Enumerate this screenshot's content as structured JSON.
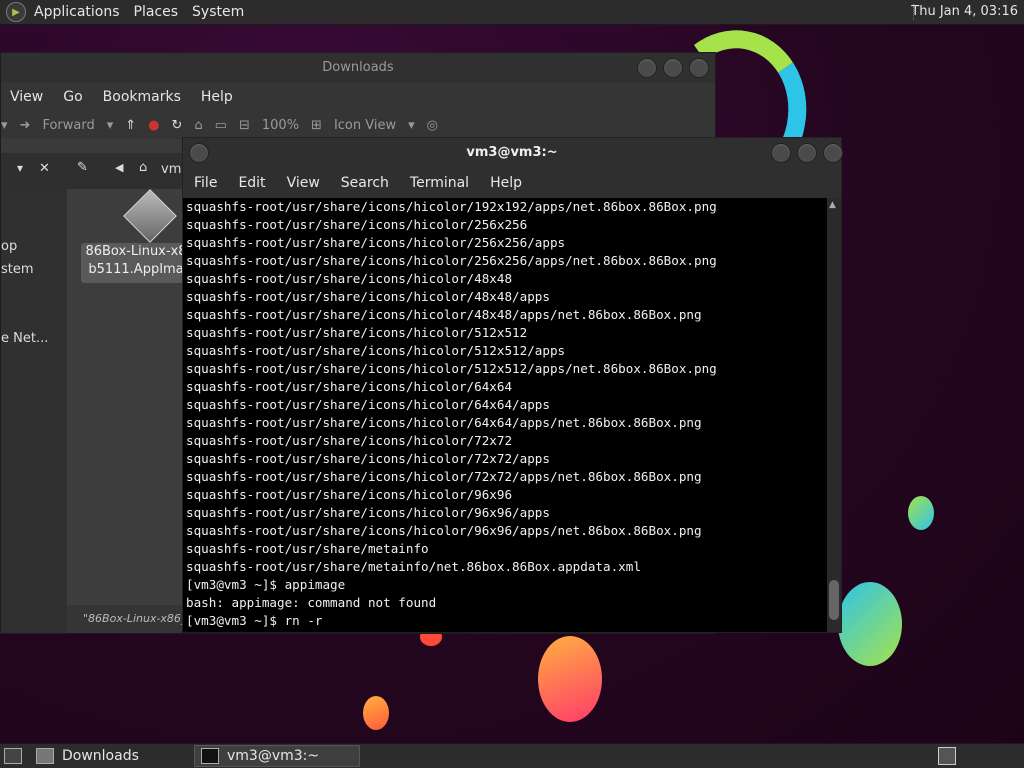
{
  "top_panel": {
    "menus": [
      "Applications",
      "Places",
      "System"
    ],
    "clock": "Thu Jan  4, 03:16"
  },
  "file_manager": {
    "title": "Downloads",
    "menus": [
      "View",
      "Go",
      "Bookmarks",
      "Help"
    ],
    "toolbar": {
      "forward_label": "Forward",
      "zoom": "100%",
      "view_mode": "Icon View"
    },
    "path_crumb": "vm3",
    "sidebar_items": [
      "op",
      "stem",
      "e Net..."
    ],
    "file_label_line1": "86Box-Linux-x8",
    "file_label_line2": "b5111.AppIma",
    "status": "\"86Box-Linux-x86_6"
  },
  "terminal": {
    "title": "vm3@vm3:~",
    "menus": [
      "File",
      "Edit",
      "View",
      "Search",
      "Terminal",
      "Help"
    ],
    "lines": [
      "squashfs-root/usr/share/icons/hicolor/192x192/apps/net.86box.86Box.png",
      "squashfs-root/usr/share/icons/hicolor/256x256",
      "squashfs-root/usr/share/icons/hicolor/256x256/apps",
      "squashfs-root/usr/share/icons/hicolor/256x256/apps/net.86box.86Box.png",
      "squashfs-root/usr/share/icons/hicolor/48x48",
      "squashfs-root/usr/share/icons/hicolor/48x48/apps",
      "squashfs-root/usr/share/icons/hicolor/48x48/apps/net.86box.86Box.png",
      "squashfs-root/usr/share/icons/hicolor/512x512",
      "squashfs-root/usr/share/icons/hicolor/512x512/apps",
      "squashfs-root/usr/share/icons/hicolor/512x512/apps/net.86box.86Box.png",
      "squashfs-root/usr/share/icons/hicolor/64x64",
      "squashfs-root/usr/share/icons/hicolor/64x64/apps",
      "squashfs-root/usr/share/icons/hicolor/64x64/apps/net.86box.86Box.png",
      "squashfs-root/usr/share/icons/hicolor/72x72",
      "squashfs-root/usr/share/icons/hicolor/72x72/apps",
      "squashfs-root/usr/share/icons/hicolor/72x72/apps/net.86box.86Box.png",
      "squashfs-root/usr/share/icons/hicolor/96x96",
      "squashfs-root/usr/share/icons/hicolor/96x96/apps",
      "squashfs-root/usr/share/icons/hicolor/96x96/apps/net.86box.86Box.png",
      "squashfs-root/usr/share/metainfo",
      "squashfs-root/usr/share/metainfo/net.86box.86Box.appdata.xml",
      "[vm3@vm3 ~]$ appimage",
      "bash: appimage: command not found",
      "[vm3@vm3 ~]$ rn -r"
    ]
  },
  "taskbar": {
    "tasks": [
      "Downloads",
      "vm3@vm3:~"
    ]
  },
  "colors": {
    "accent_green": "#a6e24a",
    "accent_cyan": "#2ec4e8",
    "bubble_orange": "#ff7a3a"
  }
}
